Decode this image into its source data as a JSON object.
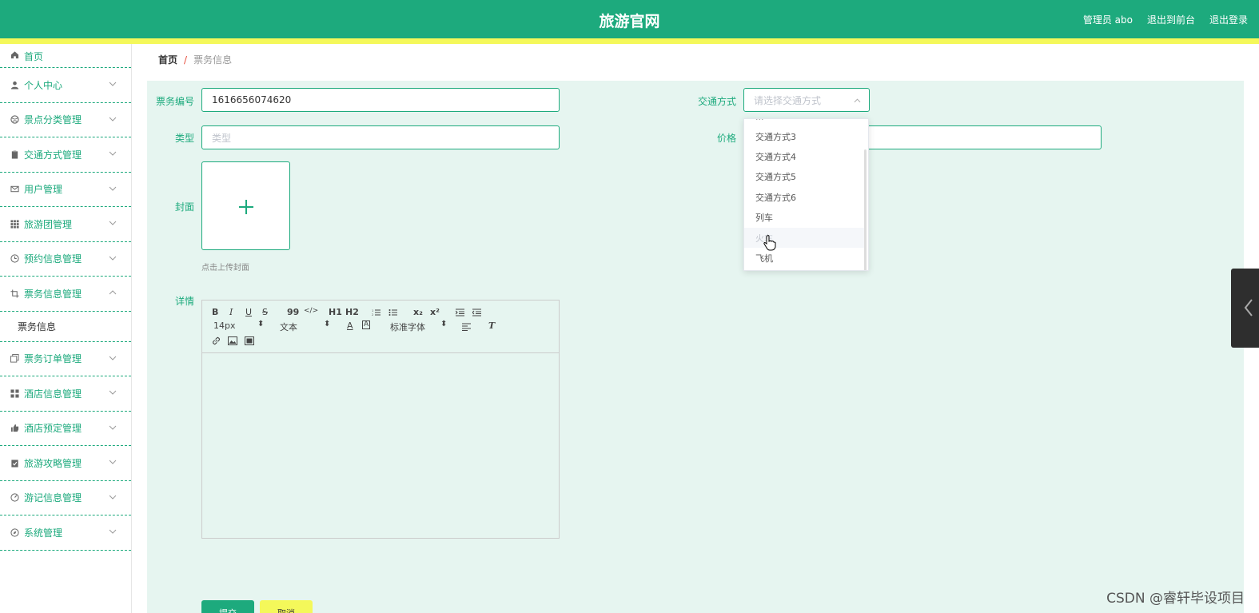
{
  "header": {
    "title": "旅游官网",
    "admin": "管理员 abo",
    "back_front": "退出到前台",
    "logout": "退出登录"
  },
  "sidebar": {
    "items": [
      {
        "label": "首页",
        "icon": "home-icon"
      },
      {
        "label": "个人中心",
        "icon": "user-icon"
      },
      {
        "label": "景点分类管理",
        "icon": "globe-icon"
      },
      {
        "label": "交通方式管理",
        "icon": "clipboard-icon"
      },
      {
        "label": "用户管理",
        "icon": "mail-icon"
      },
      {
        "label": "旅游团管理",
        "icon": "grid-icon"
      },
      {
        "label": "预约信息管理",
        "icon": "clock-icon"
      },
      {
        "label": "票务信息管理",
        "icon": "crop-icon"
      },
      {
        "label": "票务信息",
        "icon": ""
      },
      {
        "label": "票务订单管理",
        "icon": "copy-icon"
      },
      {
        "label": "酒店信息管理",
        "icon": "apps-icon"
      },
      {
        "label": "酒店预定管理",
        "icon": "thumb-icon"
      },
      {
        "label": "旅游攻略管理",
        "icon": "checklist-icon"
      },
      {
        "label": "游记信息管理",
        "icon": "gauge-icon"
      },
      {
        "label": "系统管理",
        "icon": "compass-icon"
      }
    ]
  },
  "breadcrumb": {
    "home": "首页",
    "separator": "/",
    "current": "票务信息"
  },
  "form": {
    "ticket_no_label": "票务编号",
    "ticket_no_value": "1616656074620",
    "transport_label": "交通方式",
    "transport_placeholder": "请选择交通方式",
    "type_label": "类型",
    "type_placeholder": "类型",
    "price_label": "价格",
    "cover_label": "封面",
    "cover_hint": "点击上传封面",
    "detail_label": "详情"
  },
  "editor_toolbar": {
    "bold": "B",
    "italic": "I",
    "underline": "U",
    "strike": "S",
    "quote": "99",
    "code": "</>",
    "h1": "H1",
    "h2": "H2",
    "size": "14px",
    "text": "文本",
    "font": "标准字体",
    "sub": "x₂",
    "sup": "x²"
  },
  "dropdown": {
    "options": [
      "交通方式3",
      "交通方式4",
      "交通方式5",
      "交通方式6",
      "列车",
      "火车",
      "飞机"
    ],
    "hovered": "火车"
  },
  "buttons": {
    "submit": "提交",
    "cancel": "取消"
  },
  "watermark": "CSDN @睿轩毕设项目",
  "colors": {
    "primary": "#1daa7d",
    "accent_yellow": "#f4f85a",
    "panel_bg": "#e6f5f0"
  }
}
